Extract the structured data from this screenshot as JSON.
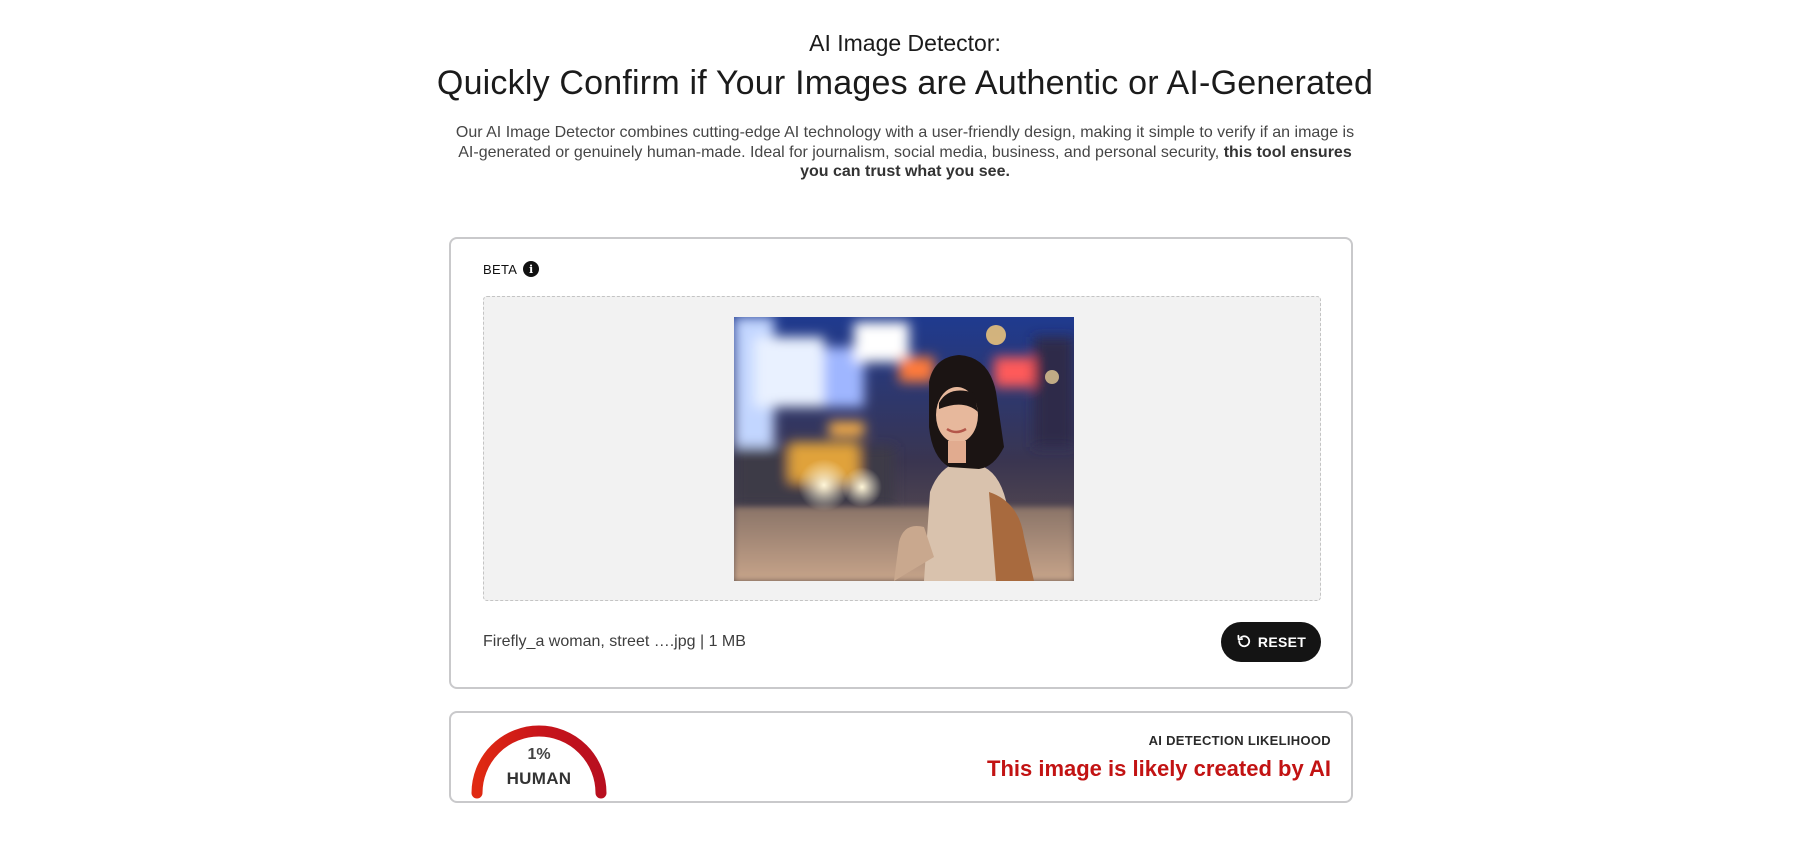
{
  "hero": {
    "kicker": "AI Image Detector:",
    "headline": "Quickly Confirm if Your Images are Authentic or AI-Generated",
    "description": "Our AI Image Detector combines cutting-edge AI technology with a user-friendly design, making it simple to verify if an image is AI-generated or genuinely human-made. Ideal for journalism, social media, business, and personal security,",
    "description_bold": "this tool ensures you can trust what you see."
  },
  "upload": {
    "badge": "BETA",
    "info_icon": "info-icon",
    "file_label": "Firefly_a woman, street ….jpg | 1 MB",
    "reset_label": "RESET",
    "reset_icon": "reset-icon"
  },
  "result": {
    "gauge_value": "1%",
    "gauge_label": "HUMAN",
    "gauge_fraction": 0.01,
    "title": "AI DETECTION LIKELIHOOD",
    "verdict": "This image is likely created by AI",
    "verdict_color": "#c21313"
  }
}
